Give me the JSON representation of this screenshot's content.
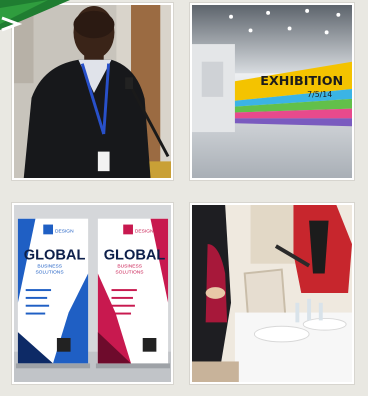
{
  "accent_green": "#2f9d3e",
  "gallery": {
    "tiles": [
      {
        "icon": "speaker-photo"
      },
      {
        "icon": "exhibition-hall-photo",
        "title": "EXHIBITION",
        "date": "7/5/14"
      },
      {
        "icon": "rollup-banners-photo",
        "brand": "DESIGN",
        "banner_title": "GLOBAL",
        "banner_subtitle_1": "BUSINESS",
        "banner_subtitle_2": "SOLUTIONS"
      },
      {
        "icon": "catering-table-photo"
      }
    ]
  }
}
